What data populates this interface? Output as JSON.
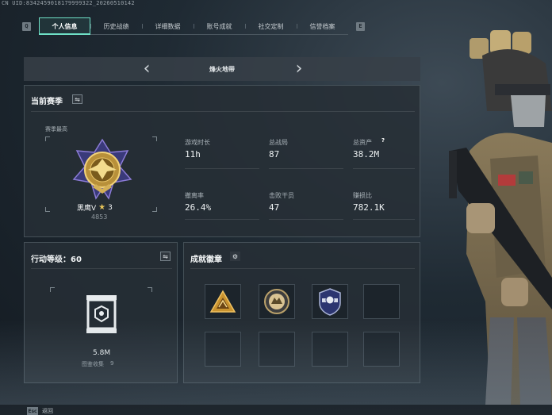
{
  "uid": "CN UID:8342459018179999322_20260510142",
  "watermark": "",
  "tabs": [
    {
      "key": "Q",
      "label": null
    },
    {
      "label": "个人信息",
      "active": true
    },
    {
      "label": "历史战绩"
    },
    {
      "label": "详细数据"
    },
    {
      "label": "账号成就"
    },
    {
      "label": "社交定制"
    },
    {
      "label": "信誉档案"
    }
  ],
  "tab_keys": {
    "left": "Q",
    "right": "E"
  },
  "map_selector": {
    "name": "烽火地带",
    "prev_icon": "chevron-left-icon",
    "next_icon": "chevron-right-icon"
  },
  "season": {
    "title": "当前赛季",
    "best_label": "赛季最高",
    "rank_name": "黑鹰V",
    "rank_stars": "3",
    "rank_points": "4853",
    "stats": [
      {
        "label": "游戏时长",
        "value": "11h"
      },
      {
        "label": "总战局",
        "value": "87"
      },
      {
        "label": "总资产",
        "value": "38.2M",
        "help": "?"
      },
      {
        "label": "撤离率",
        "value": "26.4%"
      },
      {
        "label": "击败干员",
        "value": "47"
      },
      {
        "label": "赚损比",
        "value": "782.1K"
      }
    ]
  },
  "action_level": {
    "title": "行动等级：60",
    "value": "5.8M",
    "collection_label": "图鉴收集",
    "collection_count": "9"
  },
  "badges": {
    "title": "成就徽章",
    "slots": [
      {
        "icon": "triangle-emblem-icon",
        "filled": true
      },
      {
        "icon": "round-emblem-icon",
        "filled": true
      },
      {
        "icon": "shield-emblem-icon",
        "filled": true
      },
      {
        "icon": null,
        "filled": false
      },
      {
        "icon": null,
        "filled": false
      },
      {
        "icon": null,
        "filled": false
      },
      {
        "icon": null,
        "filled": false
      },
      {
        "icon": null,
        "filled": false
      }
    ]
  },
  "bottom": {
    "key": "Esc",
    "label": "返回"
  },
  "colors": {
    "accent": "#6fe0c6",
    "gold": "#c9a24a"
  }
}
